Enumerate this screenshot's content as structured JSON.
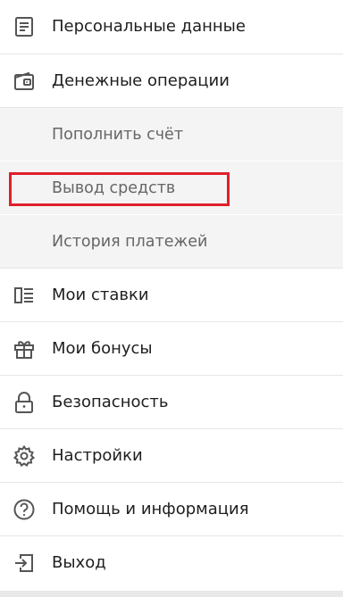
{
  "menu": {
    "items": [
      {
        "label": "Персональные данные",
        "icon": "document-icon"
      },
      {
        "label": "Денежные операции",
        "icon": "wallet-icon"
      },
      {
        "label": "Пополнить счёт"
      },
      {
        "label": "Вывод средств",
        "highlighted": true
      },
      {
        "label": "История платежей"
      },
      {
        "label": "Мои ставки",
        "icon": "bets-list-icon"
      },
      {
        "label": "Мои бонусы",
        "icon": "gift-icon"
      },
      {
        "label": "Безопасность",
        "icon": "lock-icon"
      },
      {
        "label": "Настройки",
        "icon": "gear-icon"
      },
      {
        "label": "Помощь и информация",
        "icon": "help-icon"
      },
      {
        "label": "Выход",
        "icon": "logout-icon"
      }
    ]
  },
  "colors": {
    "highlight": "#e0202a",
    "submenu_background": "#f4f4f4",
    "icon": "#555555"
  }
}
